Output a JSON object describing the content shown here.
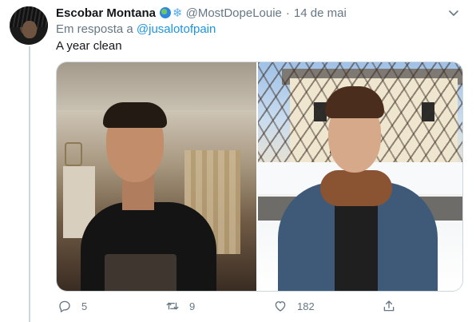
{
  "tweet": {
    "display_name": "Escobar Montana",
    "emojis": [
      "globe-icon",
      "snowflake-icon"
    ],
    "handle": "@MostDopeLouie",
    "separator": "·",
    "date": "14 de mai",
    "reply_prefix": "Em resposta a",
    "reply_mention": "@jusalotofpain",
    "text": "A year clean",
    "media": [
      {
        "name": "photo-before",
        "description_icon": "photo"
      },
      {
        "name": "photo-after",
        "description_icon": "photo"
      }
    ]
  },
  "actions": {
    "reply_count": "5",
    "retweet_count": "9",
    "like_count": "182"
  },
  "colors": {
    "text": "#14171a",
    "secondary": "#657786",
    "link": "#1b95e0",
    "border": "#ccd6dd"
  }
}
